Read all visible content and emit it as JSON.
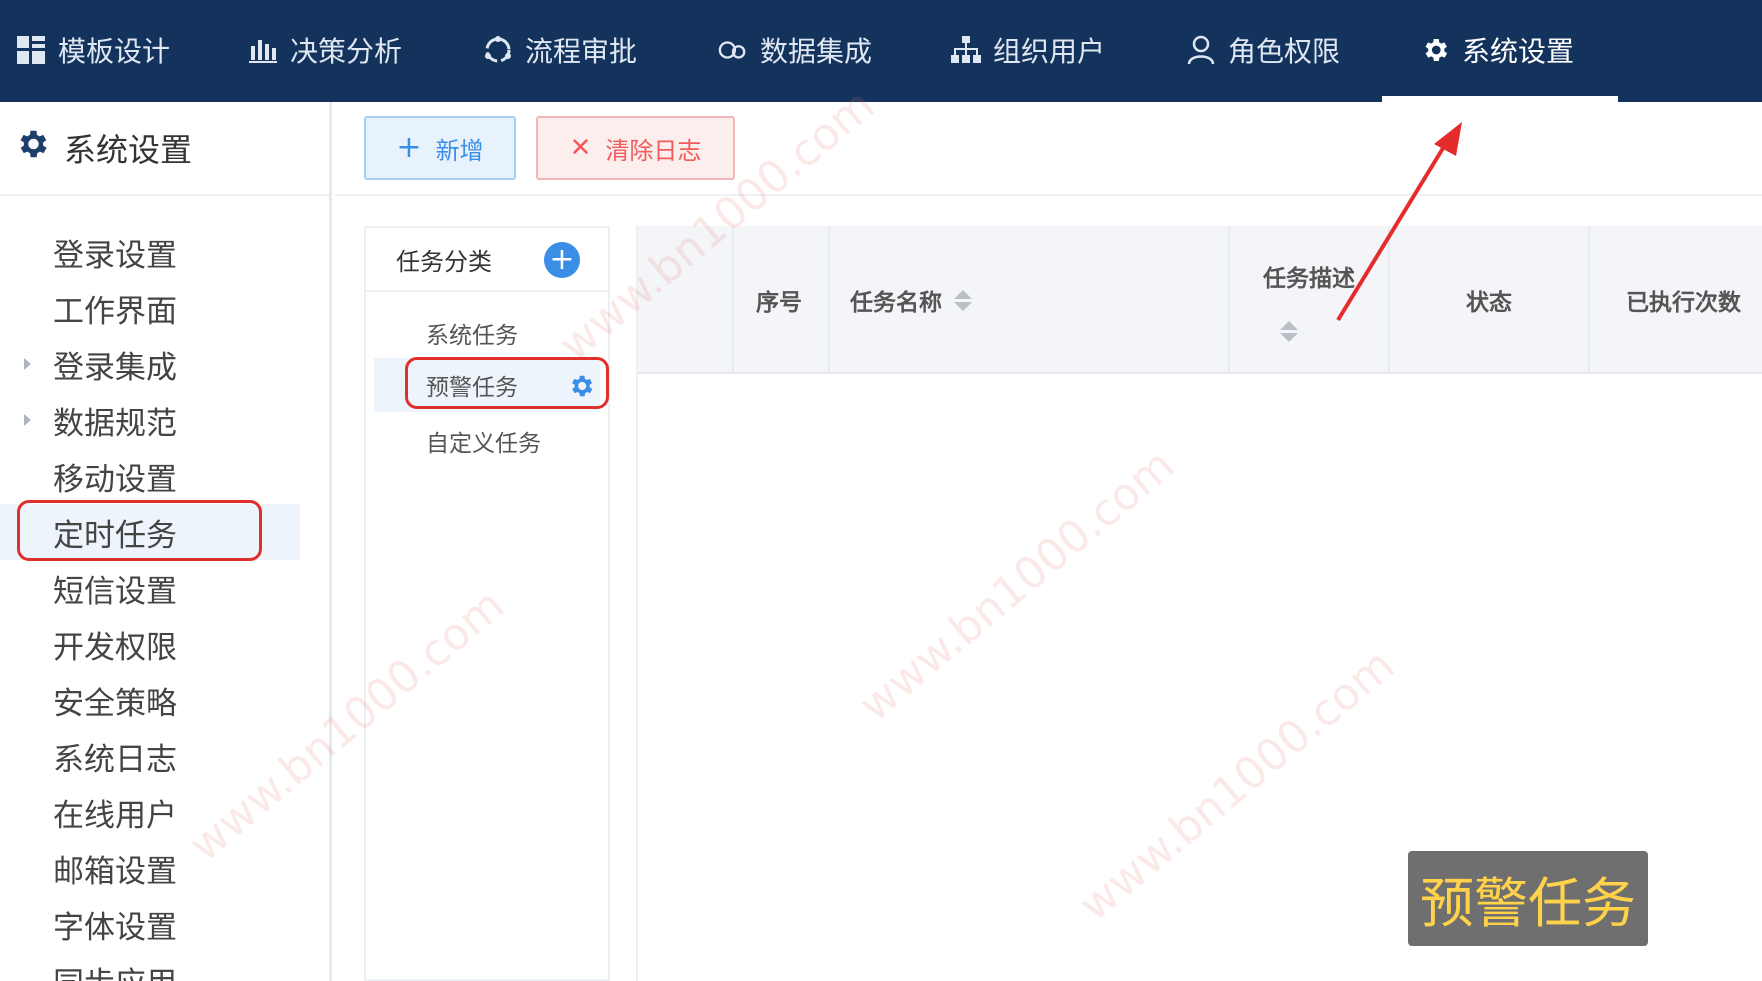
{
  "nav": {
    "items": [
      {
        "label": "模板设计",
        "icon": "grid-icon"
      },
      {
        "label": "决策分析",
        "icon": "bar-chart-icon"
      },
      {
        "label": "流程审批",
        "icon": "cycle-icon"
      },
      {
        "label": "数据集成",
        "icon": "link-icon"
      },
      {
        "label": "组织用户",
        "icon": "org-tree-icon"
      },
      {
        "label": "角色权限",
        "icon": "user-icon"
      },
      {
        "label": "系统设置",
        "icon": "gear-icon",
        "active": true
      }
    ]
  },
  "sidebar": {
    "title": "系统设置",
    "items": [
      {
        "label": "登录设置"
      },
      {
        "label": "工作界面"
      },
      {
        "label": "登录集成",
        "expandable": true
      },
      {
        "label": "数据规范",
        "expandable": true
      },
      {
        "label": "移动设置"
      },
      {
        "label": "定时任务",
        "selected": true
      },
      {
        "label": "短信设置"
      },
      {
        "label": "开发权限"
      },
      {
        "label": "安全策略"
      },
      {
        "label": "系统日志"
      },
      {
        "label": "在线用户"
      },
      {
        "label": "邮箱设置"
      },
      {
        "label": "字体设置"
      },
      {
        "label": "同步应用"
      }
    ]
  },
  "toolbar": {
    "add_label": "新增",
    "clear_label": "清除日志"
  },
  "category": {
    "title": "任务分类",
    "items": [
      {
        "label": "系统任务"
      },
      {
        "label": "预警任务",
        "selected": true
      },
      {
        "label": "自定义任务"
      }
    ]
  },
  "table": {
    "columns": [
      {
        "label": ""
      },
      {
        "label": "序号"
      },
      {
        "label": "任务名称",
        "sortable": true
      },
      {
        "label": "任务描述",
        "sortable": true
      },
      {
        "label": "状态"
      },
      {
        "label": "已执行次数"
      }
    ],
    "rows": []
  },
  "watermark": "www.bn1000.com",
  "caption": "预警任务",
  "colors": {
    "topbar": "#14335c",
    "accent": "#3a8ee6",
    "danger": "#f05c5c",
    "highlight": "#e0302b",
    "caption_text": "#ffd24a"
  }
}
